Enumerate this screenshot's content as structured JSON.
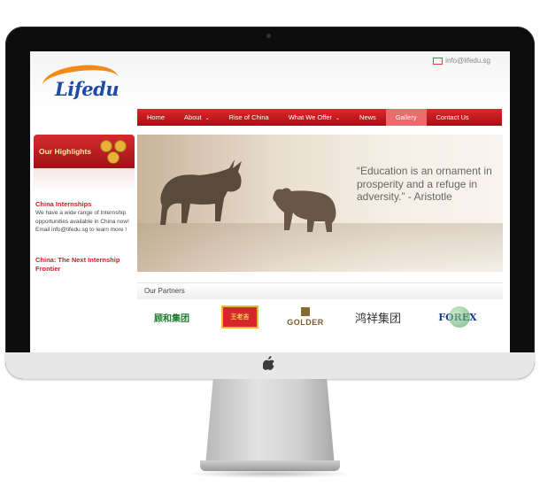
{
  "site": {
    "logo_text": "Lifedu",
    "contact_email": "info@lifedu.sg"
  },
  "nav": {
    "items": [
      {
        "label": "Home",
        "has_dropdown": false,
        "active": false
      },
      {
        "label": "About",
        "has_dropdown": true,
        "active": false
      },
      {
        "label": "Rise of China",
        "has_dropdown": false,
        "active": false
      },
      {
        "label": "What We Offer",
        "has_dropdown": true,
        "active": false
      },
      {
        "label": "News",
        "has_dropdown": false,
        "active": false
      },
      {
        "label": "Gallery",
        "has_dropdown": false,
        "active": true
      },
      {
        "label": "Contact Us",
        "has_dropdown": false,
        "active": false
      }
    ],
    "dropdown_icon": "chevron-down-icon"
  },
  "sidebar": {
    "highlights_label": "Our Highlights",
    "items": [
      {
        "heading": "China Internships",
        "text": "We have a wide range of Internship opportunities available in China now!  Email info@lifedu.sg to learn more !"
      },
      {
        "heading": "China: The Next Internship Frontier",
        "text": ""
      }
    ]
  },
  "banner": {
    "quote": "“Education is an ornament in prosperity and a refuge in adversity.” - Aristotle"
  },
  "partners": {
    "title": "Our Partners",
    "logos": [
      {
        "name": "顾和集团",
        "text": "顾和集团"
      },
      {
        "name": "王老吉",
        "text": "王老吉"
      },
      {
        "name": "GOLDER markets",
        "text": "GOLDER"
      },
      {
        "name": "鸿祥集团",
        "text": "鸿祥集团"
      },
      {
        "name": "FOREX ASIA",
        "text": "FOREX"
      }
    ]
  },
  "colors": {
    "nav_red": "#c4161c",
    "nav_active": "#ec6b6d",
    "logo_blue": "#1f4aa6",
    "logo_orange": "#f28a1a",
    "sidebar_heading_red": "#cc1e24"
  }
}
